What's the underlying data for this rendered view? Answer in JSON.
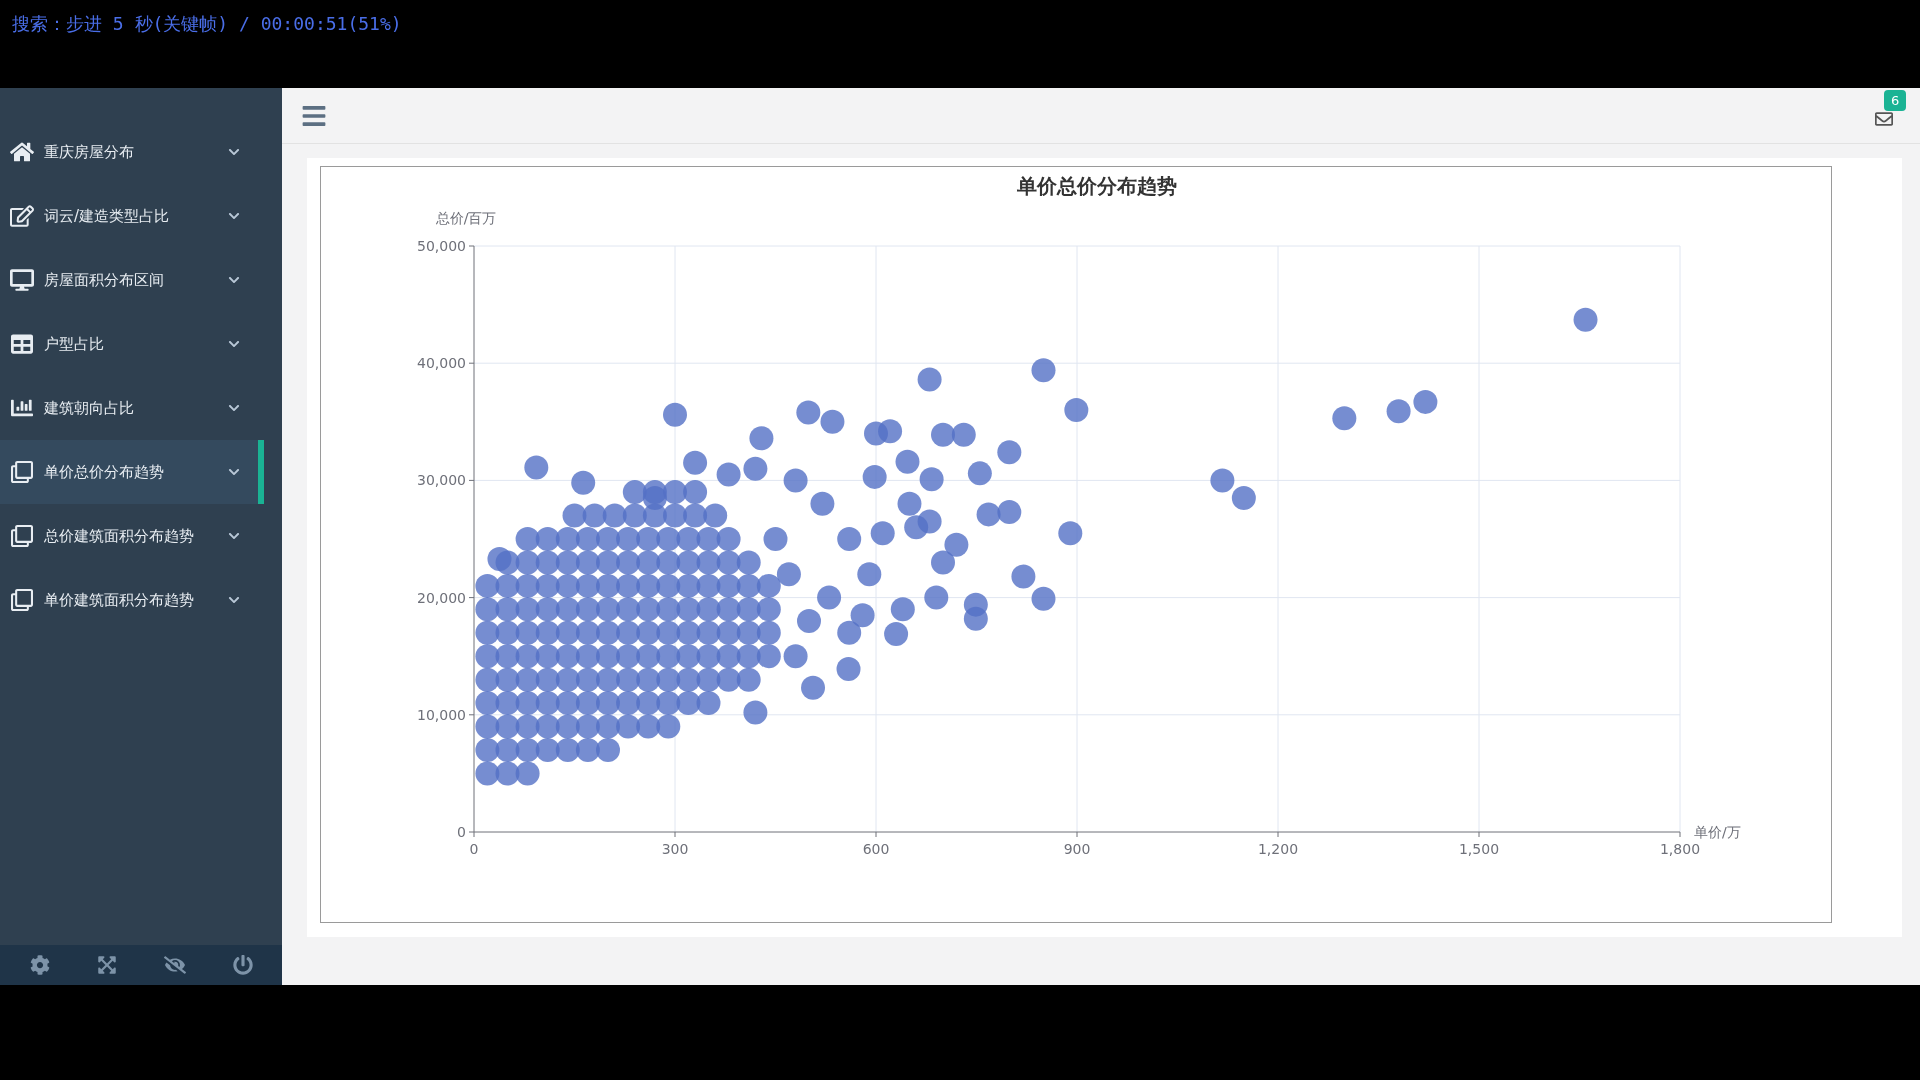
{
  "player_osd": {
    "text": "搜索：步进 5 秒(关键帧) / 00:00:51(51%)"
  },
  "sidebar": {
    "items": [
      {
        "label": "重庆房屋分布",
        "selected": false
      },
      {
        "label": "词云/建造类型占比",
        "selected": false
      },
      {
        "label": "房屋面积分布区间",
        "selected": false
      },
      {
        "label": "户型占比",
        "selected": false
      },
      {
        "label": "建筑朝向占比",
        "selected": false
      },
      {
        "label": "单价总价分布趋势",
        "selected": true
      },
      {
        "label": "总价建筑面积分布趋势",
        "selected": false
      },
      {
        "label": "单价建筑面积分布趋势",
        "selected": false
      }
    ]
  },
  "header": {
    "mail_badge": "6"
  },
  "chart": {
    "chart_data": {
      "type": "scatter",
      "title": "单价总价分布趋势",
      "xlabel": "单价/万",
      "ylabel": "总价/百万",
      "grid": true,
      "xlim": [
        0,
        1800
      ],
      "ylim": [
        0,
        50000
      ],
      "xticks": [
        {
          "value": 0,
          "label": "0"
        },
        {
          "value": 300,
          "label": "300"
        },
        {
          "value": 600,
          "label": "600"
        },
        {
          "value": 900,
          "label": "900"
        },
        {
          "value": 1200,
          "label": "1,200"
        },
        {
          "value": 1500,
          "label": "1,500"
        },
        {
          "value": 1800,
          "label": "1,800"
        }
      ],
      "yticks": [
        {
          "value": 0,
          "label": "0"
        },
        {
          "value": 10000,
          "label": "10,000"
        },
        {
          "value": 20000,
          "label": "20,000"
        },
        {
          "value": 30000,
          "label": "30,000"
        },
        {
          "value": 40000,
          "label": "40,000"
        },
        {
          "value": 50000,
          "label": "50,000"
        }
      ],
      "x": [
        20,
        50,
        80,
        20,
        50,
        80,
        110,
        140,
        170,
        200,
        20,
        50,
        80,
        110,
        140,
        170,
        200,
        230,
        260,
        290,
        20,
        50,
        80,
        110,
        140,
        170,
        200,
        230,
        260,
        290,
        320,
        350,
        20,
        50,
        80,
        110,
        140,
        170,
        200,
        230,
        260,
        290,
        320,
        350,
        380,
        410,
        20,
        50,
        80,
        110,
        140,
        170,
        200,
        230,
        260,
        290,
        320,
        350,
        380,
        410,
        440,
        20,
        50,
        80,
        110,
        140,
        170,
        200,
        230,
        260,
        290,
        320,
        350,
        380,
        410,
        440,
        20,
        50,
        80,
        110,
        140,
        170,
        200,
        230,
        260,
        290,
        320,
        350,
        380,
        410,
        440,
        20,
        50,
        80,
        110,
        140,
        170,
        200,
        230,
        260,
        290,
        320,
        350,
        380,
        410,
        440,
        50,
        80,
        110,
        140,
        170,
        200,
        230,
        260,
        290,
        320,
        350,
        380,
        410,
        80,
        110,
        140,
        170,
        200,
        230,
        260,
        290,
        320,
        350,
        380,
        150,
        180,
        210,
        240,
        270,
        300,
        330,
        360,
        240,
        270,
        300,
        330,
        1659,
        1420,
        1380,
        1299,
        1149,
        1117,
        899,
        850,
        890,
        850,
        820,
        680,
        799,
        799,
        768,
        749,
        749,
        731,
        700,
        755,
        683,
        630,
        559,
        506,
        420,
        300,
        93,
        163,
        38,
        499,
        535,
        429,
        598,
        647,
        600,
        621,
        660,
        700,
        690,
        640,
        590,
        560,
        520,
        480,
        470,
        500,
        530,
        480,
        560,
        610,
        580,
        450,
        420,
        380,
        330,
        270,
        650,
        720,
        680
      ],
      "series": [
        {
          "color": "#5470c6",
          "values": [
            5000,
            5000,
            5000,
            7000,
            7000,
            7000,
            7000,
            7000,
            7000,
            7000,
            9000,
            9000,
            9000,
            9000,
            9000,
            9000,
            9000,
            9000,
            9000,
            9000,
            11000,
            11000,
            11000,
            11000,
            11000,
            11000,
            11000,
            11000,
            11000,
            11000,
            11000,
            11000,
            13000,
            13000,
            13000,
            13000,
            13000,
            13000,
            13000,
            13000,
            13000,
            13000,
            13000,
            13000,
            13000,
            13000,
            15000,
            15000,
            15000,
            15000,
            15000,
            15000,
            15000,
            15000,
            15000,
            15000,
            15000,
            15000,
            15000,
            15000,
            15000,
            17000,
            17000,
            17000,
            17000,
            17000,
            17000,
            17000,
            17000,
            17000,
            17000,
            17000,
            17000,
            17000,
            17000,
            17000,
            19000,
            19000,
            19000,
            19000,
            19000,
            19000,
            19000,
            19000,
            19000,
            19000,
            19000,
            19000,
            19000,
            19000,
            19000,
            21000,
            21000,
            21000,
            21000,
            21000,
            21000,
            21000,
            21000,
            21000,
            21000,
            21000,
            21000,
            21000,
            21000,
            21000,
            23000,
            23000,
            23000,
            23000,
            23000,
            23000,
            23000,
            23000,
            23000,
            23000,
            23000,
            23000,
            23000,
            25000,
            25000,
            25000,
            25000,
            25000,
            25000,
            25000,
            25000,
            25000,
            25000,
            25000,
            27000,
            27000,
            27000,
            27000,
            27000,
            27000,
            27000,
            27000,
            29000,
            29000,
            29000,
            29000,
            43700,
            36700,
            35900,
            35300,
            28500,
            30000,
            36000,
            39400,
            25500,
            19900,
            21800,
            38600,
            32400,
            27300,
            27100,
            19400,
            18200,
            33900,
            33900,
            30600,
            30100,
            16900,
            13900,
            12300,
            10200,
            35600,
            31100,
            29800,
            23300,
            35800,
            35000,
            33600,
            30300,
            31600,
            34000,
            34200,
            26000,
            23000,
            20000,
            19000,
            22000,
            25000,
            28000,
            30000,
            22000,
            18000,
            20000,
            15000,
            17000,
            25500,
            18500,
            25000,
            31000,
            30500,
            31500,
            28500,
            28000,
            24500,
            26500
          ]
        }
      ]
    }
  }
}
